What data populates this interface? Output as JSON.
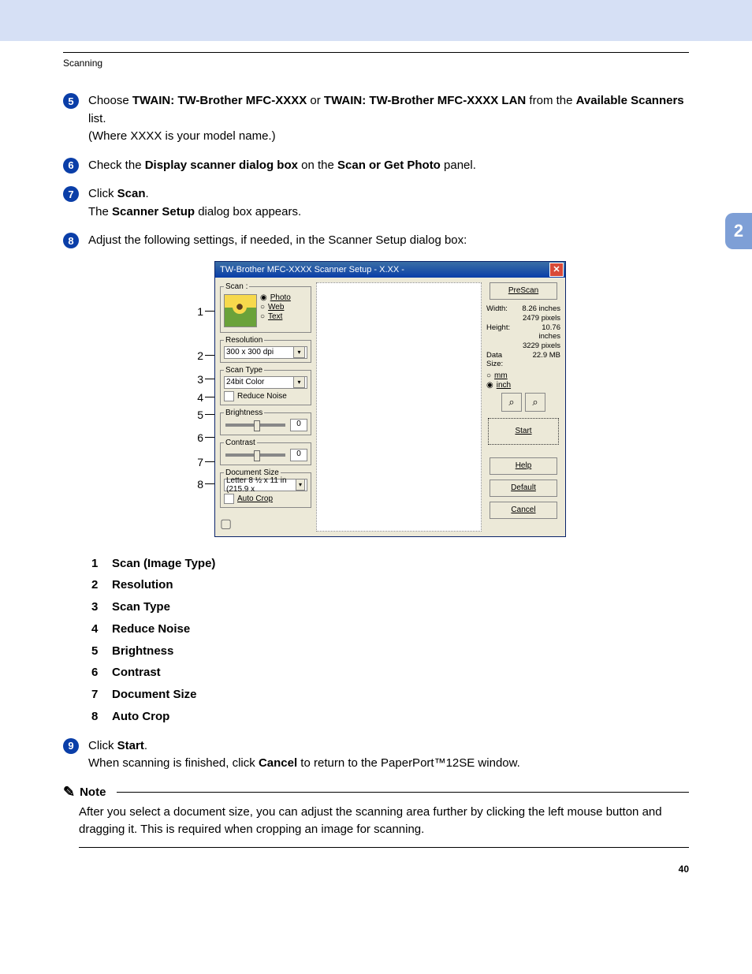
{
  "header": {
    "section": "Scanning"
  },
  "chapter_tab": "2",
  "page_number": "40",
  "steps": {
    "s5": {
      "num": "5",
      "pre": "Choose ",
      "b1": "TWAIN: TW-Brother MFC-XXXX",
      "mid": " or ",
      "b2": "TWAIN: TW-Brother MFC-XXXX LAN",
      "post1": " from the ",
      "b3": "Available Scanners",
      "post2": " list.",
      "line2": "(Where XXXX is your model name.)"
    },
    "s6": {
      "num": "6",
      "pre": "Check the ",
      "b1": "Display scanner dialog box",
      "mid": " on the ",
      "b2": "Scan or Get Photo",
      "post": " panel."
    },
    "s7": {
      "num": "7",
      "pre": "Click ",
      "b1": "Scan",
      "post": ".",
      "line2a": "The ",
      "line2b": "Scanner Setup",
      "line2c": " dialog box appears."
    },
    "s8": {
      "num": "8",
      "text": "Adjust the following settings, if needed, in the Scanner Setup dialog box:"
    },
    "s9": {
      "num": "9",
      "pre": "Click ",
      "b1": "Start",
      "post": ".",
      "line2a": "When scanning is finished, click ",
      "line2b": "Cancel",
      "line2c": " to return to the PaperPort™12SE window."
    }
  },
  "leaders": [
    "1",
    "2",
    "3",
    "4",
    "5",
    "6",
    "7",
    "8"
  ],
  "dialog": {
    "title": "TW-Brother MFC-XXXX Scanner Setup - X.XX -",
    "scan_legend": "Scan :",
    "radio_photo": "Photo",
    "radio_web": "Web",
    "radio_text": "Text",
    "resolution_legend": "Resolution",
    "resolution_value": "300 x 300 dpi",
    "scantype_legend": "Scan Type",
    "scantype_value": "24bit Color",
    "reduce_noise": "Reduce Noise",
    "brightness_legend": "Brightness",
    "brightness_value": "0",
    "contrast_legend": "Contrast",
    "contrast_value": "0",
    "docsize_legend": "Document Size",
    "docsize_value": "Letter 8 ½ x 11 in (215.9 x ",
    "autocrop": "Auto Crop",
    "prescan": "PreScan",
    "width_label": "Width:",
    "width_in": "8.26 inches",
    "width_px": "2479 pixels",
    "height_label": "Height:",
    "height_in": "10.76 inches",
    "height_px": "3229 pixels",
    "datasize_label": "Data Size:",
    "datasize_val": "22.9 MB",
    "unit_mm": "mm",
    "unit_inch": "inch",
    "btn_start": "Start",
    "btn_help": "Help",
    "btn_default": "Default",
    "btn_cancel": "Cancel"
  },
  "legend_list": [
    {
      "n": "1",
      "t": "Scan (Image Type)"
    },
    {
      "n": "2",
      "t": "Resolution"
    },
    {
      "n": "3",
      "t": "Scan Type"
    },
    {
      "n": "4",
      "t": "Reduce Noise"
    },
    {
      "n": "5",
      "t": "Brightness"
    },
    {
      "n": "6",
      "t": "Contrast"
    },
    {
      "n": "7",
      "t": "Document Size"
    },
    {
      "n": "8",
      "t": "Auto Crop"
    }
  ],
  "note": {
    "heading": "Note",
    "body": "After you select a document size, you can adjust the scanning area further by clicking the left mouse button and dragging it. This is required when cropping an image for scanning."
  }
}
